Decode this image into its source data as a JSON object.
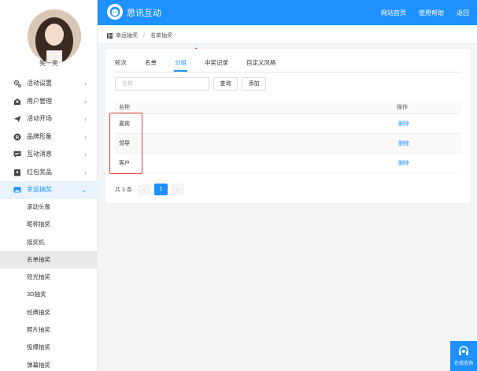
{
  "header": {
    "brand": "思讯互动",
    "nav": [
      "网站首页",
      "使用帮助",
      "返回"
    ]
  },
  "sidebar": {
    "username": "笑一笑",
    "items": [
      {
        "label": "活动设置",
        "icon": "gear-icon"
      },
      {
        "label": "用户管理",
        "icon": "user-icon"
      },
      {
        "label": "活动开场",
        "icon": "send-icon"
      },
      {
        "label": "品牌形象",
        "icon": "registered-icon"
      },
      {
        "label": "互动消息",
        "icon": "message-icon"
      },
      {
        "label": "红包奖品",
        "icon": "gift-icon"
      },
      {
        "label": "幸运抽奖",
        "icon": "image-icon"
      }
    ],
    "subitems": [
      "滚动头像",
      "昵称抽奖",
      "摇奖机",
      "名单抽奖",
      "短光抽奖",
      "3D抽奖",
      "经典抽奖",
      "照片抽奖",
      "投爆抽奖",
      "弹幕抽奖"
    ]
  },
  "breadcrumb": {
    "items": [
      "幸运抽奖",
      "名单抽奖"
    ],
    "separator": "/"
  },
  "tabs": [
    "轮次",
    "名单",
    "分组",
    "中奖记录",
    "自定义风格"
  ],
  "toolbar": {
    "search_placeholder": "名称",
    "search_label": "查询",
    "add_label": "添加"
  },
  "table": {
    "headers": [
      "名称",
      "操作"
    ],
    "rows": [
      {
        "name": "嘉宾",
        "action": "删除"
      },
      {
        "name": "领导",
        "action": "删除"
      },
      {
        "name": "客户",
        "action": "删除"
      }
    ]
  },
  "pagination": {
    "total_text": "共 3 条",
    "prev": "‹",
    "current": "1",
    "next": "›"
  },
  "chat": {
    "label": "在线咨询"
  },
  "colors": {
    "accent": "#1e90ff",
    "highlight": "#e53935"
  }
}
